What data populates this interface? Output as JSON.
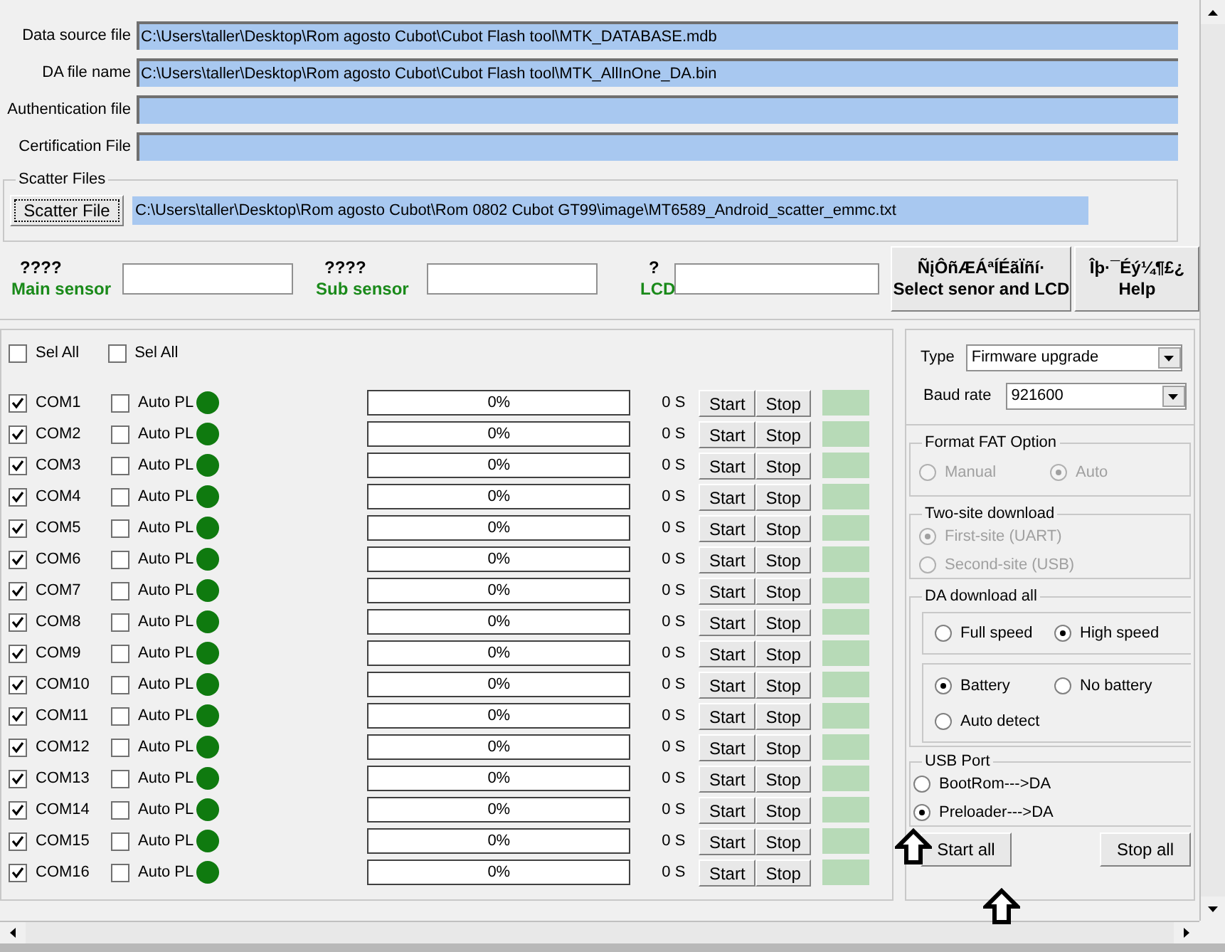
{
  "file_fields": [
    {
      "label": "Data source file",
      "value": "C:\\Users\\taller\\Desktop\\Rom agosto Cubot\\Cubot Flash tool\\MTK_DATABASE.mdb"
    },
    {
      "label": "DA file name",
      "value": "C:\\Users\\taller\\Desktop\\Rom agosto Cubot\\Cubot Flash tool\\MTK_AllInOne_DA.bin"
    },
    {
      "label": "Authentication file"
    },
    {
      "label": "Certification File"
    }
  ],
  "scatter": {
    "title": "Scatter Files",
    "button": "Scatter File",
    "value": "C:\\Users\\taller\\Desktop\\Rom agosto Cubot\\Rom 0802 Cubot GT99\\image\\MT6589_Android_scatter_emmc.txt"
  },
  "sensors": [
    {
      "value": "????",
      "label": "Main sensor"
    },
    {
      "value": "????",
      "label": "Sub sensor"
    },
    {
      "value": "?",
      "label": "LCD"
    }
  ],
  "select_button": {
    "line1": "ÑįÔñÆÁªÍÉãÏñí·",
    "line2": "Select senor and LCD"
  },
  "help_button": {
    "line1": "Îþ·¯Éý¼¶£¿",
    "line2": "Help"
  },
  "select_all": [
    {
      "label": "Sel All",
      "checked": false
    },
    {
      "label": "Sel All",
      "checked": false
    }
  ],
  "ports": [
    {
      "name": "COM1",
      "checked": true,
      "auto": "Auto PL",
      "auto_checked": false,
      "progress": "0%",
      "level": 0,
      "time": "0 S",
      "start": "Start",
      "stop": "Stop"
    },
    {
      "name": "COM2",
      "checked": true,
      "auto": "Auto PL",
      "auto_checked": false,
      "progress": "0%",
      "level": 0,
      "time": "0 S",
      "start": "Start",
      "stop": "Stop"
    },
    {
      "name": "COM3",
      "checked": true,
      "auto": "Auto PL",
      "auto_checked": false,
      "progress": "0%",
      "level": 0,
      "time": "0 S",
      "start": "Start",
      "stop": "Stop"
    },
    {
      "name": "COM4",
      "checked": true,
      "auto": "Auto PL",
      "auto_checked": false,
      "progress": "0%",
      "level": 0,
      "time": "0 S",
      "start": "Start",
      "stop": "Stop"
    },
    {
      "name": "COM5",
      "checked": true,
      "auto": "Auto PL",
      "auto_checked": false,
      "progress": "0%",
      "level": 0,
      "time": "0 S",
      "start": "Start",
      "stop": "Stop"
    },
    {
      "name": "COM6",
      "checked": true,
      "auto": "Auto PL",
      "auto_checked": false,
      "progress": "0%",
      "level": 0,
      "time": "0 S",
      "start": "Start",
      "stop": "Stop"
    },
    {
      "name": "COM7",
      "checked": true,
      "auto": "Auto PL",
      "auto_checked": false,
      "progress": "0%",
      "level": 0,
      "time": "0 S",
      "start": "Start",
      "stop": "Stop"
    },
    {
      "name": "COM8",
      "checked": true,
      "auto": "Auto PL",
      "auto_checked": false,
      "progress": "0%",
      "level": 0,
      "time": "0 S",
      "start": "Start",
      "stop": "Stop"
    },
    {
      "name": "COM9",
      "checked": true,
      "auto": "Auto PL",
      "auto_checked": false,
      "progress": "0%",
      "level": 0,
      "time": "0 S",
      "start": "Start",
      "stop": "Stop"
    },
    {
      "name": "COM10",
      "checked": true,
      "auto": "Auto PL",
      "auto_checked": false,
      "progress": "0%",
      "level": 0,
      "time": "0 S",
      "start": "Start",
      "stop": "Stop"
    },
    {
      "name": "COM11",
      "checked": true,
      "auto": "Auto PL",
      "auto_checked": false,
      "progress": "0%",
      "level": 0,
      "time": "0 S",
      "start": "Start",
      "stop": "Stop"
    },
    {
      "name": "COM12",
      "checked": true,
      "auto": "Auto PL",
      "auto_checked": false,
      "progress": "0%",
      "level": 0,
      "time": "0 S",
      "start": "Start",
      "stop": "Stop"
    },
    {
      "name": "COM13",
      "checked": true,
      "auto": "Auto PL",
      "auto_checked": false,
      "progress": "0%",
      "level": 0,
      "time": "0 S",
      "start": "Start",
      "stop": "Stop"
    },
    {
      "name": "COM14",
      "checked": true,
      "auto": "Auto PL",
      "auto_checked": false,
      "progress": "0%",
      "level": 0,
      "time": "0 S",
      "start": "Start",
      "stop": "Stop"
    },
    {
      "name": "COM15",
      "checked": true,
      "auto": "Auto PL",
      "auto_checked": false,
      "progress": "0%",
      "level": 0,
      "time": "0 S",
      "start": "Start",
      "stop": "Stop"
    },
    {
      "name": "COM16",
      "checked": true,
      "auto": "Auto PL",
      "auto_checked": false,
      "progress": "0%",
      "level": 0,
      "time": "0 S",
      "start": "Start",
      "stop": "Stop"
    }
  ],
  "type": {
    "label": "Type",
    "value": "Firmware upgrade"
  },
  "baud": {
    "label": "Baud rate",
    "value": "921600"
  },
  "format_fat": {
    "title": "Format FAT Option",
    "disabled": true,
    "options": [
      {
        "label": "Manual",
        "selected": false
      },
      {
        "label": "Auto",
        "selected": true
      }
    ]
  },
  "two_site": {
    "title": "Two-site download",
    "disabled": true,
    "options": [
      {
        "label": "First-site (UART)",
        "selected": true
      },
      {
        "label": "Second-site (USB)",
        "selected": false
      }
    ]
  },
  "da_download": {
    "title": "DA download all",
    "speed": [
      {
        "label": "Full speed",
        "selected": false
      },
      {
        "label": "High speed",
        "selected": true
      }
    ],
    "battery": [
      {
        "label": "Battery",
        "selected": true
      },
      {
        "label": "No battery",
        "selected": false
      },
      {
        "label": "Auto detect",
        "selected": false
      }
    ]
  },
  "usb_port": {
    "title": "USB Port",
    "options": [
      {
        "label": "BootRom--->DA",
        "selected": false
      },
      {
        "label": "Preloader--->DA",
        "selected": true
      }
    ]
  },
  "start_all": "Start all",
  "stop_all": "Stop all"
}
